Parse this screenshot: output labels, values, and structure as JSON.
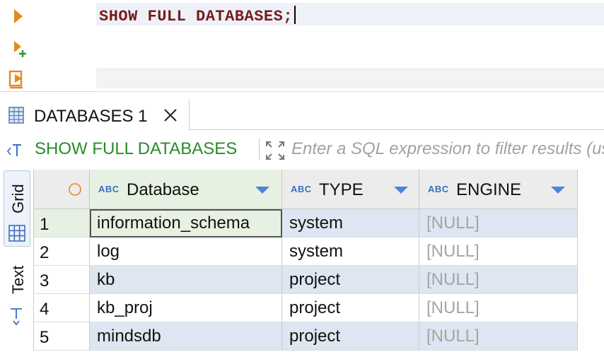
{
  "editor": {
    "sql": "SHOW FULL DATABASES;",
    "icons": [
      "execute-statement-icon",
      "execute-new-tab-icon",
      "execute-script-icon"
    ]
  },
  "result_tab": {
    "label": "DATABASES 1",
    "icon": "table-grid-icon",
    "close_icon": "close-icon"
  },
  "filter": {
    "query_text": "SHOW FULL DATABASES",
    "placeholder": "Enter a SQL expression to filter results (use Ctrl+Space)"
  },
  "side_tabs": {
    "grid_label": "Grid",
    "text_label": "Text"
  },
  "grid": {
    "type_badge": "ABC",
    "columns": [
      "Database",
      "TYPE",
      "ENGINE"
    ],
    "rows": [
      {
        "num": "1",
        "database": "information_schema",
        "type": "system",
        "engine": "[NULL]"
      },
      {
        "num": "2",
        "database": "log",
        "type": "system",
        "engine": "[NULL]"
      },
      {
        "num": "3",
        "database": "kb",
        "type": "project",
        "engine": "[NULL]"
      },
      {
        "num": "4",
        "database": "kb_proj",
        "type": "project",
        "engine": "[NULL]"
      },
      {
        "num": "5",
        "database": "mindsdb",
        "type": "project",
        "engine": "[NULL]"
      }
    ]
  },
  "colors": {
    "sql_keyword": "#7a1a1a",
    "query_green": "#2a8c2a",
    "type_blue": "#3b6fc2",
    "row_alt": "#dde6f1",
    "accent_orange": "#e38a1e"
  }
}
